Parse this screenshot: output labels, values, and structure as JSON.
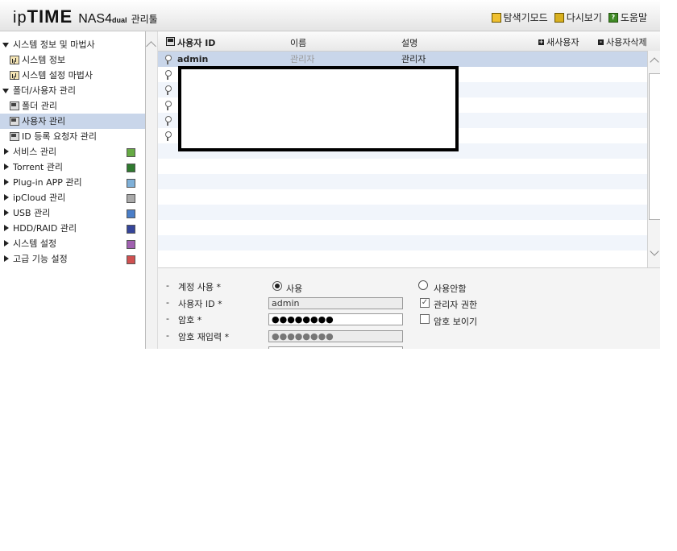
{
  "header": {
    "logo": {
      "ip": "ip",
      "time": "TIME",
      "nas": "NAS4",
      "dual": "dual",
      "manager": "관리툴"
    },
    "links": [
      {
        "label": "탐색기모드",
        "icon": "explorer-icon"
      },
      {
        "label": "다시보기",
        "icon": "refresh-icon"
      },
      {
        "label": "도움말",
        "icon": "help-icon"
      }
    ]
  },
  "sidebar": {
    "items": [
      {
        "label": "시스템 정보 및 마법사",
        "level": 0,
        "state": "expanded"
      },
      {
        "label": "시스템 정보",
        "level": 1,
        "icon": "chart-icon"
      },
      {
        "label": "시스템 설정 마법사",
        "level": 1,
        "icon": "chart-icon"
      },
      {
        "label": "폴더/사용자 관리",
        "level": 0,
        "state": "expanded"
      },
      {
        "label": "폴더 관리",
        "level": 1,
        "icon": "picture-icon"
      },
      {
        "label": "사용자 관리",
        "level": 1,
        "icon": "picture-icon",
        "selected": true
      },
      {
        "label": "ID 등록 요청자 관리",
        "level": 1,
        "icon": "picture-icon"
      },
      {
        "label": "서비스 관리",
        "level": 0,
        "state": "collapsed",
        "icon": "service-icon"
      },
      {
        "label": "Torrent 관리",
        "level": 0,
        "state": "collapsed",
        "icon": "torrent-icon"
      },
      {
        "label": "Plug-in APP 관리",
        "level": 0,
        "state": "collapsed",
        "icon": "plugin-icon"
      },
      {
        "label": "ipCloud 관리",
        "level": 0,
        "state": "collapsed",
        "icon": "cloud-icon"
      },
      {
        "label": "USB 관리",
        "level": 0,
        "state": "collapsed",
        "icon": "usb-icon"
      },
      {
        "label": "HDD/RAID 관리",
        "level": 0,
        "state": "collapsed",
        "icon": "hdd-icon"
      },
      {
        "label": "시스템 설정",
        "level": 0,
        "state": "collapsed",
        "icon": "settings-icon"
      },
      {
        "label": "고급 기능 설정",
        "level": 0,
        "state": "collapsed",
        "icon": "advanced-icon"
      }
    ]
  },
  "grid": {
    "columns": [
      "사용자 ID",
      "이름",
      "설명"
    ],
    "add_user_label": "새사용자",
    "delete_user_label": "사용자삭제",
    "rows": [
      {
        "id": "admin",
        "name": "관리자",
        "desc": "관리자"
      }
    ]
  },
  "form": {
    "account_use_label": "계정 사용 *",
    "account_use_on": "사용",
    "account_use_off": "사용안함",
    "account_use_value": "사용",
    "user_id_label": "사용자 ID *",
    "user_id_value": "admin",
    "password_label": "암호 *",
    "password_value": "●●●●●●●●",
    "password_confirm_label": "암호 재입력 *",
    "password_confirm_value": "●●●●●●●●",
    "admin_right_label": "관리자 권한",
    "admin_right_checked": true,
    "show_password_label": "암호 보이기",
    "show_password_checked": false
  }
}
